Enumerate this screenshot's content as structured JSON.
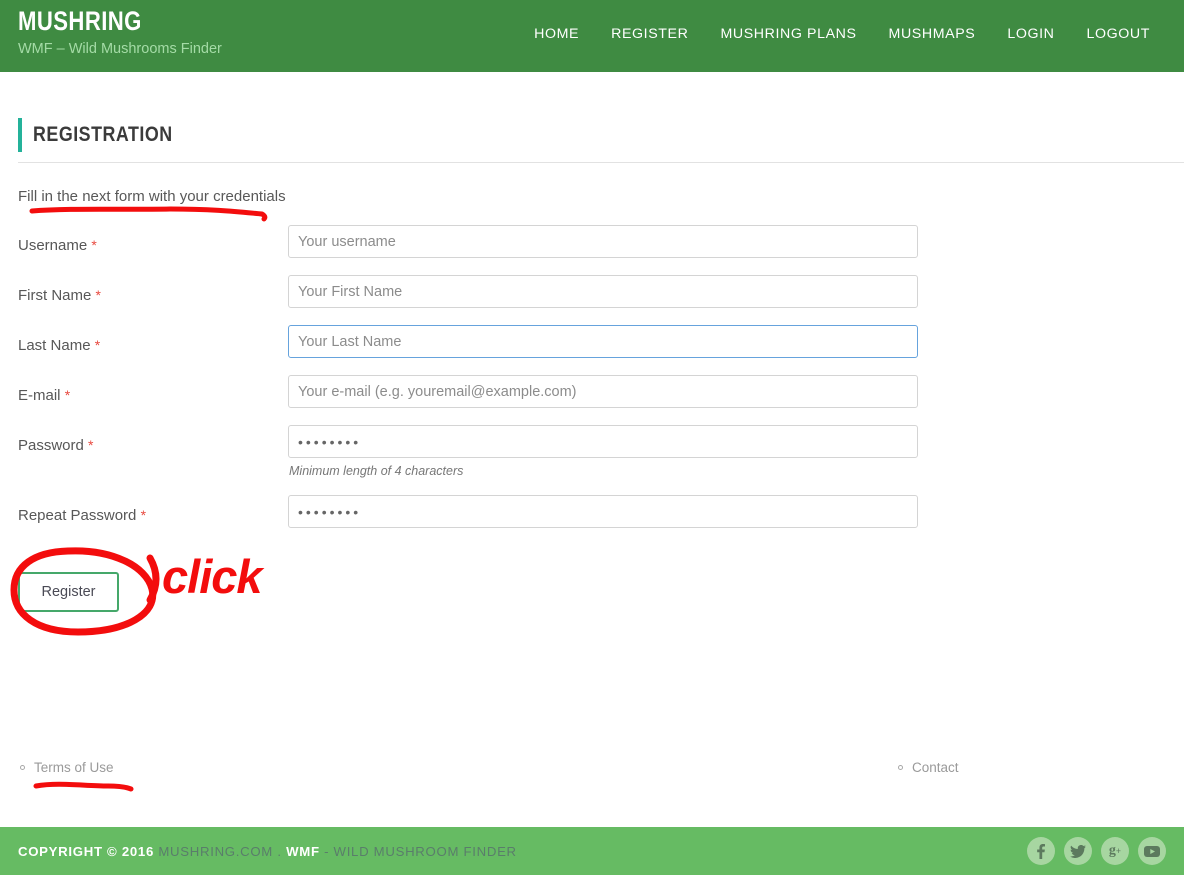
{
  "header": {
    "brand_title": "MUSHRING",
    "brand_subtitle": "WMF – Wild Mushrooms Finder",
    "bg_color": "#3f8b42",
    "nav": [
      {
        "label": "HOME"
      },
      {
        "label": "REGISTER"
      },
      {
        "label": "MUSHRING PLANS"
      },
      {
        "label": "MUSHMAPS"
      },
      {
        "label": "LOGIN"
      },
      {
        "label": "LOGOUT"
      }
    ]
  },
  "page": {
    "section_title": "REGISTRATION",
    "accent_color": "#24b29a",
    "intro": "Fill in the next form with your credentials"
  },
  "form": {
    "required_marker": "*",
    "fields": [
      {
        "label": "Username",
        "required": true,
        "placeholder": "Your username",
        "value": "",
        "type": "text",
        "focused": false,
        "help": ""
      },
      {
        "label": "First Name",
        "required": true,
        "placeholder": "Your First Name",
        "value": "",
        "type": "text",
        "focused": false,
        "help": ""
      },
      {
        "label": "Last Name",
        "required": true,
        "placeholder": "Your Last Name",
        "value": "",
        "type": "text",
        "focused": true,
        "help": ""
      },
      {
        "label": "E-mail",
        "required": true,
        "placeholder": "Your e-mail (e.g. youremail@example.com)",
        "value": "",
        "type": "email",
        "focused": false,
        "help": ""
      },
      {
        "label": "Password",
        "required": true,
        "placeholder": "",
        "value": "••••••••",
        "type": "password",
        "focused": false,
        "help": "Minimum length of 4 characters"
      },
      {
        "label": "Repeat Password",
        "required": true,
        "placeholder": "",
        "value": "••••••••",
        "type": "password",
        "focused": false,
        "help": ""
      }
    ],
    "submit_label": "Register",
    "submit_border_color": "#45a86a"
  },
  "footer": {
    "links": [
      {
        "label": "Terms of Use"
      },
      {
        "label": "Contact"
      }
    ],
    "copyright_prefix": "COPYRIGHT © 2016",
    "copyright_site": "MUSHRING.COM",
    "copyright_sep": ".",
    "copyright_wmf": "WMF",
    "copyright_tagline": "- WILD MUSHROOM FINDER",
    "bar_color": "#66bb63",
    "social": [
      {
        "name": "facebook-icon",
        "glyph": "f"
      },
      {
        "name": "twitter-icon",
        "glyph": "t"
      },
      {
        "name": "google-plus-icon",
        "glyph": "g"
      },
      {
        "name": "youtube-icon",
        "glyph": "y"
      }
    ]
  },
  "annotations": {
    "color": "#f30d0d",
    "click_label": "click",
    "underline_intro": true,
    "underline_terms": true,
    "circle_register": true
  }
}
